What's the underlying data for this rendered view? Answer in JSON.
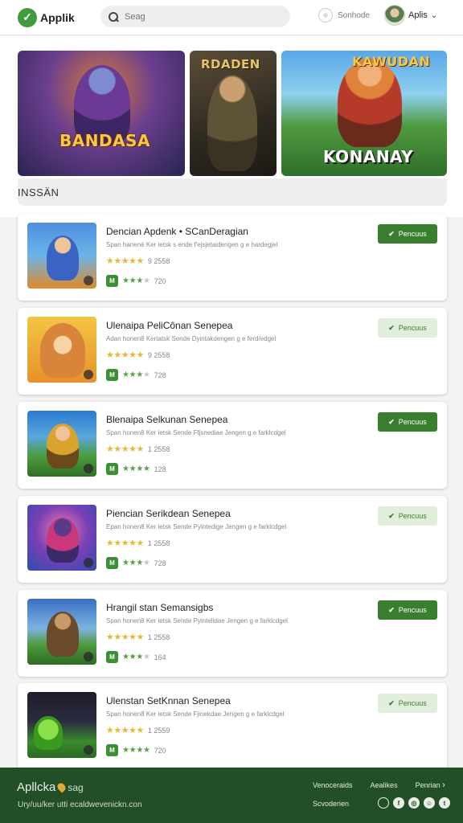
{
  "header": {
    "logo_text": "Applik",
    "search_placeholder": "Seag",
    "link_label": "Sonhode",
    "user_name": "Aplis"
  },
  "hero": {
    "banners": [
      {
        "title": "BANDASA"
      },
      {
        "title": "RDADEN"
      },
      {
        "title_top": "KAWUDAN",
        "title_bottom": "KONANAY"
      }
    ],
    "section_title": "INSSÄN"
  },
  "apps": [
    {
      "title": "Dencian Apdenk  • SCanDeragian",
      "desc": "Span hanené Ker ietsk  s ende f'ejsjetaidengen g e hardegjel",
      "rating": "9 2558",
      "meta_count": "720",
      "button": "Pencuus",
      "button_style": "solid"
    },
    {
      "title": "Ulenaipa PeliCônan  Senepea",
      "desc": "Adan honen8  Kertatsk  Sende Dyintakdengen g e ferd/edgel",
      "rating": "9 2558",
      "meta_count": "728",
      "button": "Pencuus",
      "button_style": "light"
    },
    {
      "title": "Blenaipa Selkunan  Senepea",
      "desc": "Span honen8  Ker ietsk  Sende Ffjsnediae Jengen g e farklcdgel",
      "rating": "1 2558",
      "meta_count": "128",
      "button": "Pencuus",
      "button_style": "solid"
    },
    {
      "title": "Piencian Serikdean  Senepea",
      "desc": "Epan honen8  Ker ietsk  Sende Pyintedige Jengen g e farklcdgel",
      "rating": "1 2558",
      "meta_count": "728",
      "button": "Pencuus",
      "button_style": "light"
    },
    {
      "title": "Hrangil  stan Semansigbs",
      "desc": "Span honen8  Ker ietsk  Sende Pyintelidae Jengen g e farklcdgel",
      "rating": "1 2558",
      "meta_count": "164",
      "button": "Pencuus",
      "button_style": "solid"
    },
    {
      "title": "Ulenstan SetKnnan  Senepea",
      "desc": "Span honen8  Ker ietsk  Sende Fjinekdae Jengen g e farklcdgel",
      "rating": "1 2559",
      "meta_count": "720",
      "button": "Pencuus",
      "button_style": "light"
    }
  ],
  "footer": {
    "brand": "Apllcka",
    "brand_tail": "sag",
    "tagline": "Ury/uu/ker utti ecaldwevenickn.con",
    "links": [
      "Venoceraids",
      "Aealikes",
      "Penrian"
    ],
    "sub_link": "Scvoderien"
  },
  "colors": {
    "accent": "#3a7f30",
    "footer_bg": "#234f28",
    "star": "#e9b53a"
  },
  "icons": [
    "search-icon",
    "check-icon",
    "chevron-down-icon",
    "arrow-right-icon",
    "facebook-icon",
    "instagram-icon"
  ]
}
